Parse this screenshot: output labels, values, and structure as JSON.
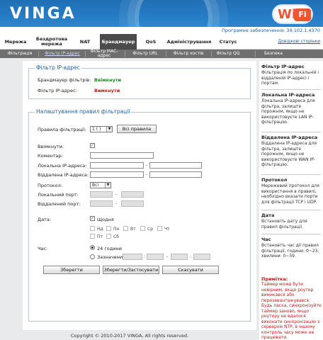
{
  "header": {
    "logo": "VINGA",
    "badge_w": "Wi",
    "badge_fi": "Fi",
    "firmware": "Програмне забезпечення: 39.102.1.4370"
  },
  "nav": {
    "items": [
      "Мережа",
      "Бездротова мережа",
      "NAT",
      "Брандмауер",
      "QoS",
      "Адміністрування",
      "Статус"
    ],
    "active": 3,
    "help_link": "Довідкові сторінки"
  },
  "subnav": {
    "items": [
      "Фільтрація",
      "Фільтр IP-адрес",
      "Фільтр MAC-адрес",
      "Фільтр URL",
      "Фільтр хостів",
      "Фільтр QQ",
      "Безпека"
    ],
    "active": 1
  },
  "ip_filter": {
    "legend": "Фільтр IP-адрес",
    "firewall_label": "Брандмауер фільтрів:",
    "firewall_value": "Ввімкнути",
    "ipfilter_label": "Фільтр IP-адрес:",
    "ipfilter_value": "Вимкнути"
  },
  "rules": {
    "legend": "Налаштування правил фільтрації",
    "rules_label": "Правила фільтрації:",
    "rules_select": "1 ( )",
    "all_rules_button": "Всі правила",
    "enable_label": "Ввімкнути:",
    "enable_checked": "✓",
    "comment_label": "Коментар:",
    "local_ip_label": "Локальна IP-адреса:",
    "remote_ip_label": "Віддалена IP-адреса:",
    "protocol_label": "Протокол:",
    "protocol_value": "Всі",
    "local_port_label": "Локальний порт:",
    "remote_port_label": "Віддалений порт:",
    "dash": "-",
    "date_label": "Дата:",
    "daily_label": "Щодня",
    "daily_checked": "✓",
    "days": [
      "Нд",
      "Пн",
      "Вт",
      "Ср",
      "Чт",
      "Пт",
      "Сб"
    ],
    "time_label": "Час:",
    "time_24h": "24 години",
    "time_custom": "Зазначений",
    "time_colon": ":",
    "save_button": "Зберегти",
    "save_apply_button": "Зберегти/Застосувати",
    "cancel_button": "Скасувати"
  },
  "help": [
    {
      "title": "Фільтр IP-адрес",
      "body": "Фільтрація по локальній і віддаленій IP-адресі і портам."
    },
    {
      "title": "Локальна IP-адреса",
      "body": "Локальна IP-адреса для фільтра, залиште порожнім, якщо не використовуєте LAN IP-фільтрацію."
    },
    {
      "title": "Віддалена IP-адреса",
      "body": "Віддалена IP-адреса для фільтра, залиште порожнім, якщо не використовуєте WAN IP-фільтрацію."
    },
    {
      "title": "Протокол",
      "body": "Мережевий протокол для використання в правилі, необхідно вказати порти для фільтрації TCP і UDP."
    },
    {
      "title": "Дата",
      "body": "Встановіть дату для правил фільтрації."
    },
    {
      "title": "Час",
      "body": "Встановіть час дії правил фільтрації, години: 0~23, хвилини: 0~59."
    }
  ],
  "note": {
    "title": "Примітка:",
    "body": "Таймер може бути невірним, якщо роутер вимикався або перезавантажувався. Будь ласка, синхронізуйте таймер заново, якщо роутеру не вдалося виконати синхронізацію з сервером NTP, в іншому контроль часу може не працювати."
  },
  "footer": "Copyright © 2010-2017 VINGA, All rights reserved."
}
